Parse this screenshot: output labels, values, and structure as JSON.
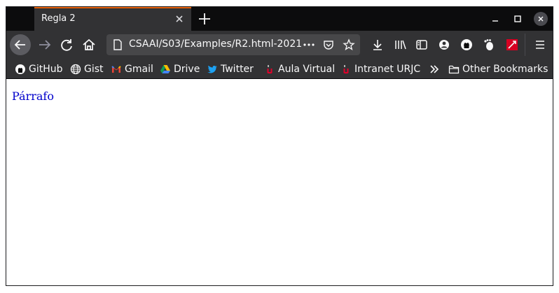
{
  "window": {
    "tab_title": "Regla 2",
    "url": "2021-CSAAI/S03/Examples/R2.html"
  },
  "icons": {
    "tab_close": "close-icon",
    "new_tab": "plus-icon",
    "minimize": "minimize-icon",
    "maximize": "maximize-icon",
    "close": "close-icon",
    "back": "back-arrow-icon",
    "forward": "forward-arrow-icon",
    "reload": "reload-icon",
    "home": "home-icon",
    "page_info": "page-icon",
    "page_actions": "more-dots-icon",
    "pocket": "pocket-icon",
    "bookmark_star": "star-icon",
    "downloads": "download-icon",
    "library": "library-icon",
    "sidebar": "sidebar-icon",
    "account": "account-icon",
    "github_ext": "github-icon",
    "gnome_ext": "gnome-foot-icon",
    "red_ext": "red-extension-icon",
    "menu": "hamburger-menu-icon"
  },
  "bookmarks": [
    {
      "label": "GitHub",
      "icon": "github-icon"
    },
    {
      "label": "Gist",
      "icon": "globe-icon"
    },
    {
      "label": "Gmail",
      "icon": "gmail-icon"
    },
    {
      "label": "Drive",
      "icon": "drive-icon"
    },
    {
      "label": "Twitter",
      "icon": "twitter-icon"
    },
    {
      "label": "Aula Virtual",
      "icon": "urjc-icon"
    },
    {
      "label": "Intranet URJC",
      "icon": "urjc-icon"
    },
    {
      "label": "",
      "icon": "chevron-double-right-icon"
    },
    {
      "label": "Other Bookmarks",
      "icon": "folder-icon"
    }
  ],
  "content": {
    "paragraph": "Párrafo"
  },
  "colors": {
    "chrome_dark": "#0c0c0d",
    "toolbar": "#323234",
    "urlbar": "#474749",
    "tab_accent": "#e66000",
    "paragraph_text": "#0000cc"
  }
}
